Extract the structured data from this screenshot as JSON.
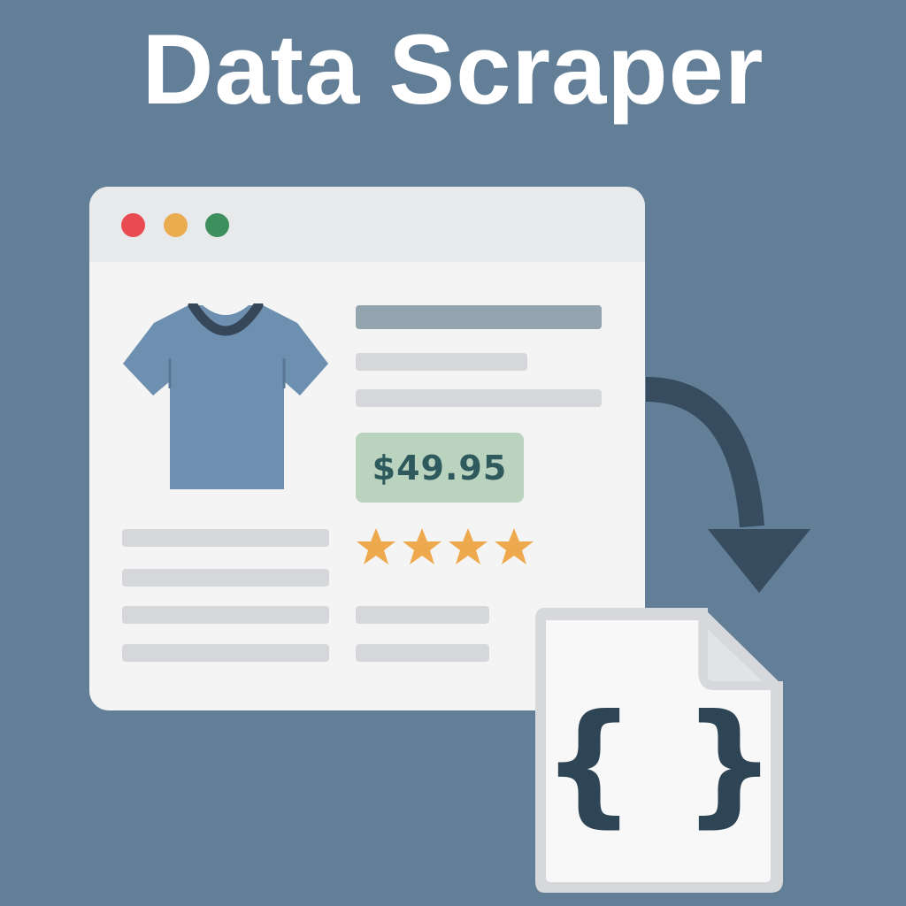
{
  "title": "Data Scraper",
  "browser": {
    "window_controls": [
      "close-dot",
      "minimize-dot",
      "maximize-dot"
    ],
    "product": {
      "image_icon": "t-shirt-icon",
      "price": "$49.95",
      "rating": {
        "stars": 4
      }
    }
  },
  "output": {
    "icon": "json-file-icon",
    "symbol": "{ }"
  },
  "colors": {
    "background": "#637f98",
    "browser_bg": "#f4f4f4",
    "price_bg": "#b9d3bf",
    "price_text": "#2e5a5d",
    "star": "#eea84d",
    "arrow": "#374c5e",
    "close": "#e94b53",
    "minimize": "#e9ac4f",
    "maximize": "#3d8f5d"
  }
}
